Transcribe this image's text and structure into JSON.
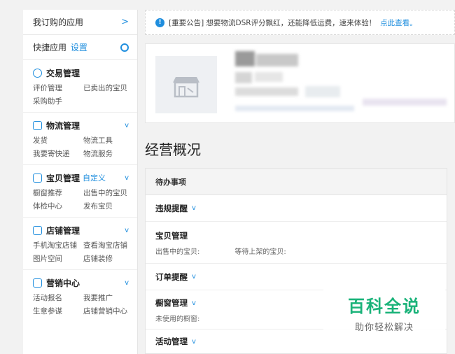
{
  "sidebar": {
    "subscribed_label": "我订购的应用",
    "subscribed_chevron": ">",
    "quick_label": "快捷应用",
    "quick_settings": "设置",
    "sections": [
      {
        "title": "交易管理",
        "custom": "",
        "caret": "",
        "links": [
          "评价管理",
          "已卖出的宝贝",
          "采购助手"
        ]
      },
      {
        "title": "物流管理",
        "custom": "",
        "caret": "v",
        "links": [
          "发货",
          "物流工具",
          "我要寄快递",
          "物流服务"
        ]
      },
      {
        "title": "宝贝管理",
        "custom": "自定义",
        "caret": "v",
        "links": [
          "橱窗推荐",
          "出售中的宝贝",
          "体检中心",
          "发布宝贝"
        ]
      },
      {
        "title": "店铺管理",
        "custom": "",
        "caret": "v",
        "links": [
          "手机淘宝店铺",
          "查看淘宝店铺",
          "图片空间",
          "店铺装修"
        ]
      },
      {
        "title": "营销中心",
        "custom": "",
        "caret": "v",
        "links": [
          "活动报名",
          "我要推广",
          "生意参谋",
          "店铺营销中心"
        ]
      }
    ]
  },
  "notice": {
    "icon": "!",
    "text": "[重要公告] 想要物流DSR评分飘红，还能降低运费，速来体验！",
    "link": "点此查看。"
  },
  "overview_title": "经营概况",
  "todo": {
    "header": "待办事项",
    "rows": [
      {
        "title": "违规提醒",
        "caret": "v",
        "subs": []
      },
      {
        "title": "宝贝管理",
        "caret": "",
        "subs": [
          "出售中的宝贝:",
          "等待上架的宝贝:"
        ]
      },
      {
        "title": "订单提醒",
        "caret": "v",
        "subs": []
      },
      {
        "title": "橱窗管理",
        "caret": "v",
        "subs": [
          "未使用的橱窗:"
        ]
      },
      {
        "title": "活动管理",
        "caret": "v",
        "subs": []
      }
    ]
  },
  "watermark": {
    "main": "百科全说",
    "sub": "助你轻松解决"
  },
  "colors": {
    "accent": "#1f8ede",
    "watermark": "#1bb37a"
  }
}
